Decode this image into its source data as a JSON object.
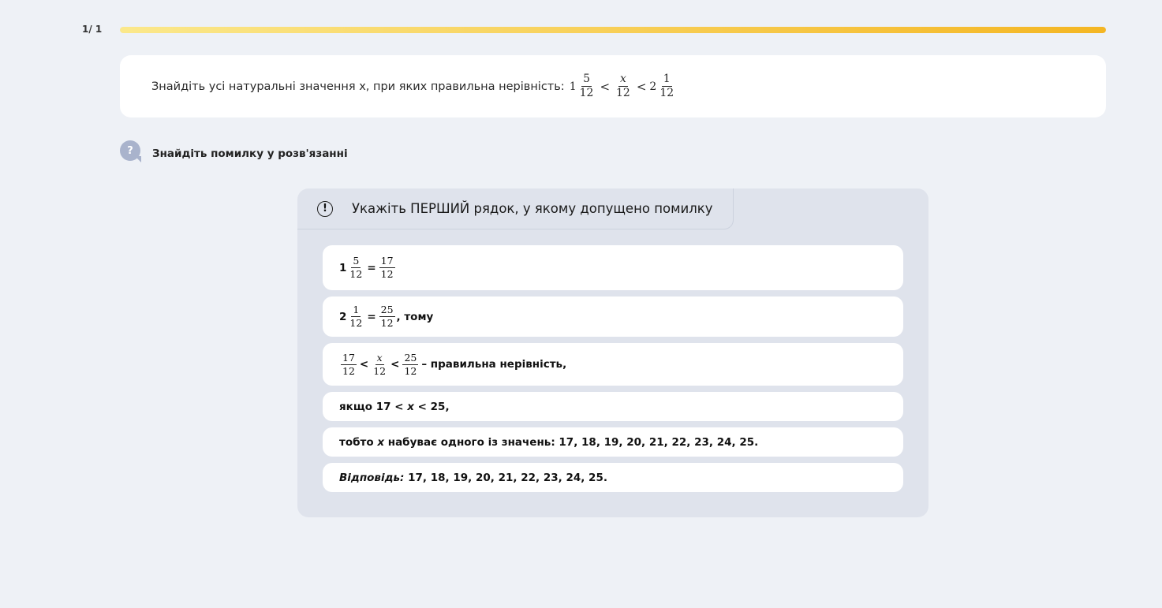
{
  "progress": {
    "counter": "1/ 1",
    "fraction": 1.0
  },
  "task": {
    "prompt": "Знайдіть усі натуральні значення x, при яких правильна нерівність:",
    "formula": {
      "whole1": "1",
      "num1": "5",
      "den1": "12",
      "lt1": "<",
      "num2": "x",
      "den2": "12",
      "lt2": "<",
      "whole3": "2",
      "num3": "1",
      "den3": "12"
    }
  },
  "hint": {
    "icon": "?",
    "text": "Знайдіть помилку у розв'язанні"
  },
  "panel": {
    "title": "Укажіть ПЕРШИЙ рядок, у якому допущено помилку",
    "icon": "!",
    "rows": [
      {
        "whole": "1",
        "num": "5",
        "den": "12",
        "eq": "=",
        "rnum": "17",
        "rden": "12"
      },
      {
        "whole": "2",
        "num": "1",
        "den": "12",
        "eq": "=",
        "rnum": "25",
        "rden": "12",
        "suffix": ", тому"
      },
      {
        "n1": "17",
        "d1": "12",
        "lt1": "<",
        "n2": "x",
        "d2": "12",
        "lt2": "<",
        "n3": "25",
        "d3": "12",
        "suffix": "– правильна нерівність,"
      },
      {
        "pre": "якщо 17 <",
        "var": "x",
        "post": "< 25,"
      },
      {
        "pre": "тобто",
        "var": "x",
        "post": "набуває одного із значень: 17, 18, 19, 20, 21, 22, 23, 24, 25."
      },
      {
        "label": "Відповідь:",
        "post": "17, 18, 19, 20, 21, 22, 23, 24, 25."
      }
    ]
  },
  "colors": {
    "background": "#eef1f6",
    "progress_start": "#fbe88b",
    "progress_end": "#f4b623",
    "panel": "#dfe3ec",
    "hint_icon": "#a9b3cc"
  }
}
